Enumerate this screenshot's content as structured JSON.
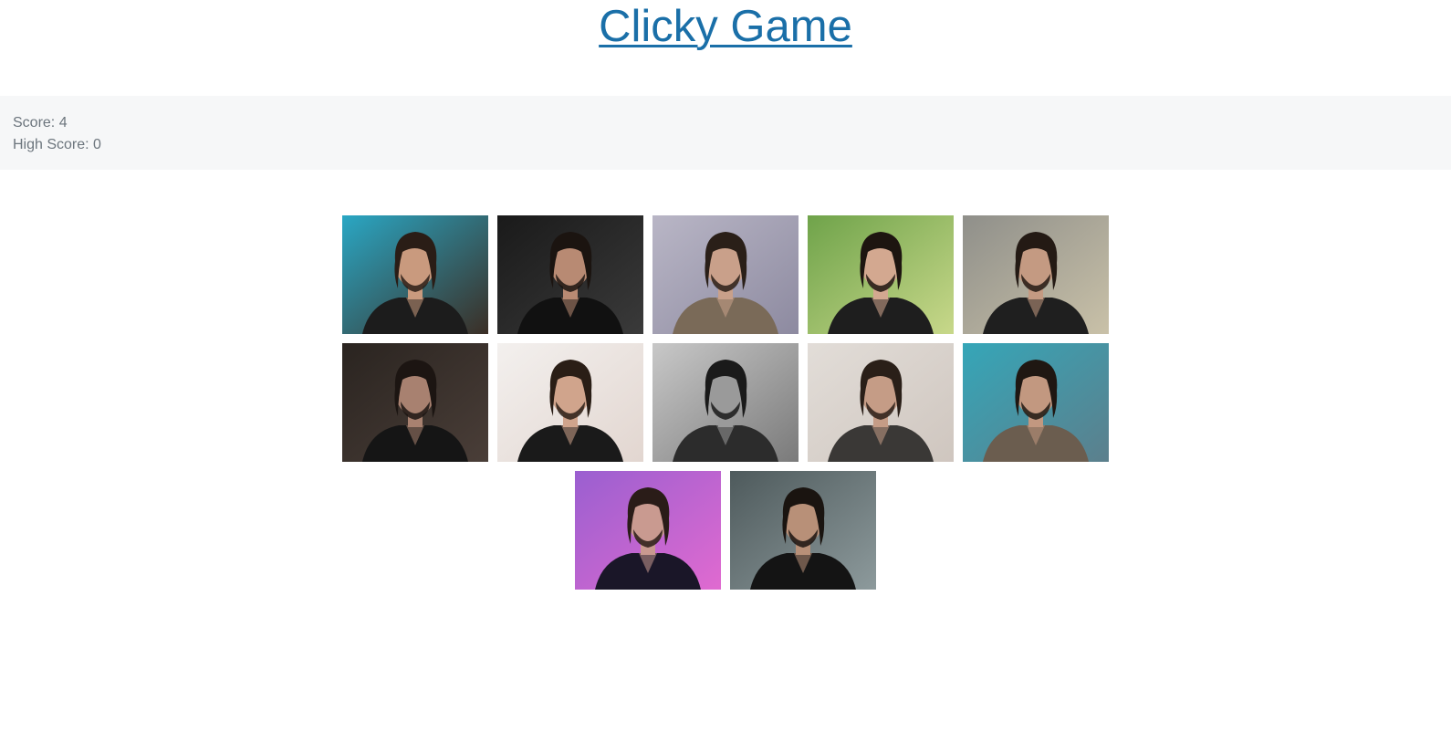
{
  "header": {
    "title": "Clicky Game"
  },
  "scoreboard": {
    "score_text": "Score: 4",
    "high_score_text": "High Score: 0"
  },
  "cards": [
    {
      "bg": "#2aa7c4",
      "bg2": "#3b2e25",
      "suit": "#1c1c1c",
      "skin": "#c99a7e",
      "hair": "#2a1d16"
    },
    {
      "bg": "#1a1a1a",
      "bg2": "#3a3a3a",
      "suit": "#111111",
      "skin": "#b88a73",
      "hair": "#1b1410"
    },
    {
      "bg": "#b9b6c6",
      "bg2": "#8d8aa0",
      "suit": "#7a6a58",
      "skin": "#c9a08a",
      "hair": "#2a1f18"
    },
    {
      "bg": "#6fa34a",
      "bg2": "#c8d88a",
      "suit": "#1e1e1e",
      "skin": "#d3a890",
      "hair": "#1d1510"
    },
    {
      "bg": "#8f8f8a",
      "bg2": "#c9c1a8",
      "suit": "#1f1f1f",
      "skin": "#c49a82",
      "hair": "#241a14"
    },
    {
      "bg": "#2a2420",
      "bg2": "#4a3e38",
      "suit": "#151515",
      "skin": "#a88170",
      "hair": "#1c1512"
    },
    {
      "bg": "#f3f0ee",
      "bg2": "#e2d6d0",
      "suit": "#1a1a1a",
      "skin": "#d0a48c",
      "hair": "#2a1e16"
    },
    {
      "bg": "#c8c8c8",
      "bg2": "#7a7a7a",
      "suit": "#2c2c2c",
      "skin": "#9a9a9a",
      "hair": "#1a1a1a"
    },
    {
      "bg": "#e2ddd8",
      "bg2": "#cfc6bf",
      "suit": "#3a3836",
      "skin": "#c59c86",
      "hair": "#2a1f18"
    },
    {
      "bg": "#35a6b8",
      "bg2": "#5c7f8c",
      "suit": "#6b5d4f",
      "skin": "#c29880",
      "hair": "#1f1712"
    },
    {
      "bg": "#9a5fd0",
      "bg2": "#e06ad0",
      "suit": "#1a1628",
      "skin": "#c99a90",
      "hair": "#2a1c18"
    },
    {
      "bg": "#4e5a5c",
      "bg2": "#8d9a9c",
      "suit": "#141414",
      "skin": "#b89078",
      "hair": "#1a1410"
    }
  ],
  "colors": {
    "title_link": "#1a6fa8",
    "score_bar_bg": "#f6f7f8",
    "score_text": "#6c757d"
  }
}
